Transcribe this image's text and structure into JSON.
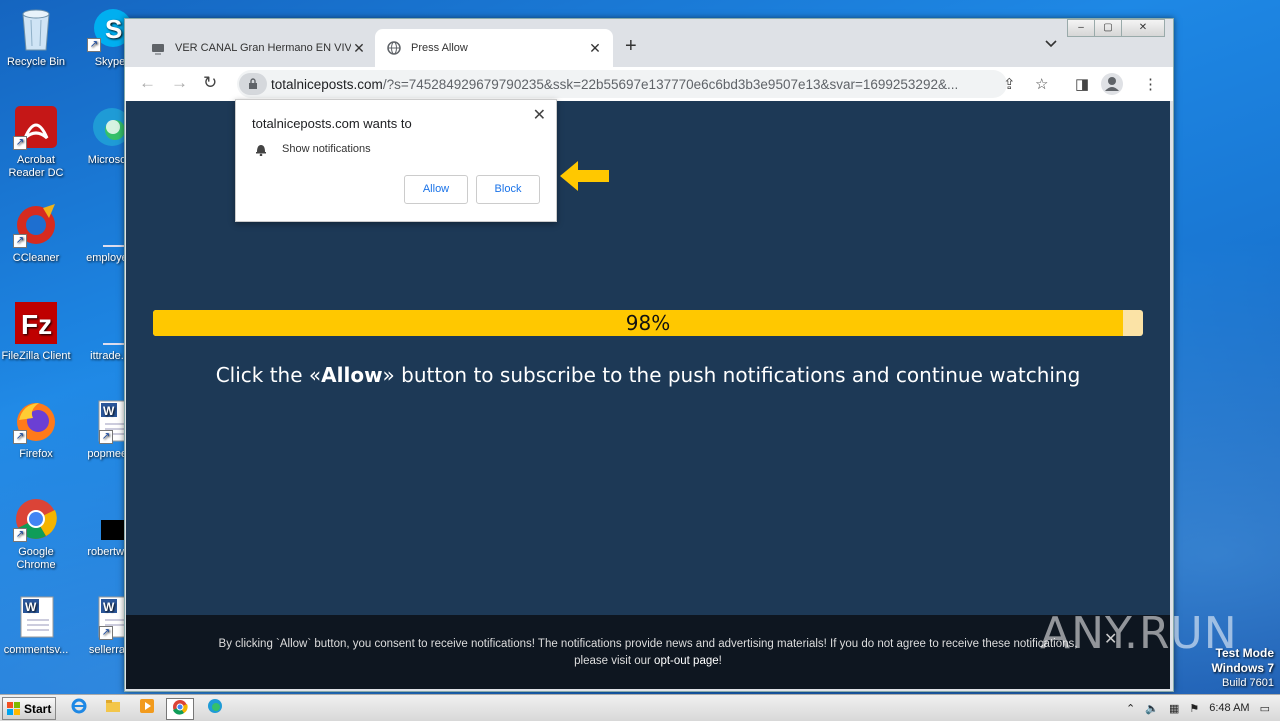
{
  "desktop": {
    "icons": [
      {
        "label": "Recycle Bin",
        "icon": "recycle-bin-icon"
      },
      {
        "label": "Skype",
        "icon": "skype-icon"
      },
      {
        "label": "Acrobat Reader DC",
        "icon": "acrobat-icon"
      },
      {
        "label": "Microsoft",
        "icon": "edge-icon"
      },
      {
        "label": "CCleaner",
        "icon": "ccleaner-icon"
      },
      {
        "label": "employee",
        "icon": "blank-file-icon"
      },
      {
        "label": "FileZilla Client",
        "icon": "filezilla-icon"
      },
      {
        "label": "ittrade.p",
        "icon": "blank-file-icon"
      },
      {
        "label": "Firefox",
        "icon": "firefox-icon"
      },
      {
        "label": "popmeeti",
        "icon": "word-doc-icon"
      },
      {
        "label": "Google Chrome",
        "icon": "chrome-icon"
      },
      {
        "label": "robertwel",
        "icon": "black-file-icon"
      },
      {
        "label": "commentsv...",
        "icon": "word-doc-icon"
      },
      {
        "label": "sellerrap",
        "icon": "word-doc-icon"
      }
    ],
    "test_mode": {
      "line1": "Test Mode",
      "line2": "Windows 7",
      "line3": "Build 7601"
    }
  },
  "browser": {
    "tabs": [
      {
        "label": "VER CANAL Gran Hermano EN VIVO",
        "close": "✕"
      },
      {
        "label": "Press Allow",
        "close": "✕"
      }
    ],
    "new_tab": "+",
    "tab_dropdown": "⌄",
    "window_controls": {
      "minimize": "‒",
      "maximize": "▢",
      "close": "✕"
    },
    "address": {
      "host": "totalniceposts.com",
      "rest": "/?s=745284929679790235&ssk=22b55697e137770e6c6bd3b3e9507e13&svar=1699253292&..."
    },
    "toolbar_icons": {
      "back": "←",
      "forward": "→",
      "reload": "↻",
      "share": "⇪",
      "star": "☆",
      "sidepanel": "◨",
      "menu": "⋮"
    }
  },
  "popup": {
    "title": "totalniceposts.com wants to",
    "permission": "Show notifications",
    "close": "✕",
    "allow": "Allow",
    "block": "Block"
  },
  "page": {
    "progress_pct": 98,
    "progress_text": "98%",
    "headline_pre": "Click the «",
    "headline_bold": "Allow",
    "headline_post": "» button to subscribe to the push notifications and continue watching",
    "consent_line1": "By clicking `Allow` button, you consent to receive notifications! The notifications provide news and advertising materials! If you do not agree to receive these notifications,",
    "consent_line2_pre": "please visit our ",
    "consent_link": "opt-out page",
    "consent_line2_post": "!",
    "consent_close": "✕",
    "accent_color": "#ffc800",
    "background_color": "#1d3956"
  },
  "watermark": {
    "text": "ANY.RUN"
  },
  "taskbar": {
    "start": "Start",
    "clock": "6:48 AM",
    "tray_icons": [
      "tray-expand-icon",
      "volume-icon",
      "network-icon",
      "flag-icon",
      "show-desktop-icon"
    ]
  }
}
